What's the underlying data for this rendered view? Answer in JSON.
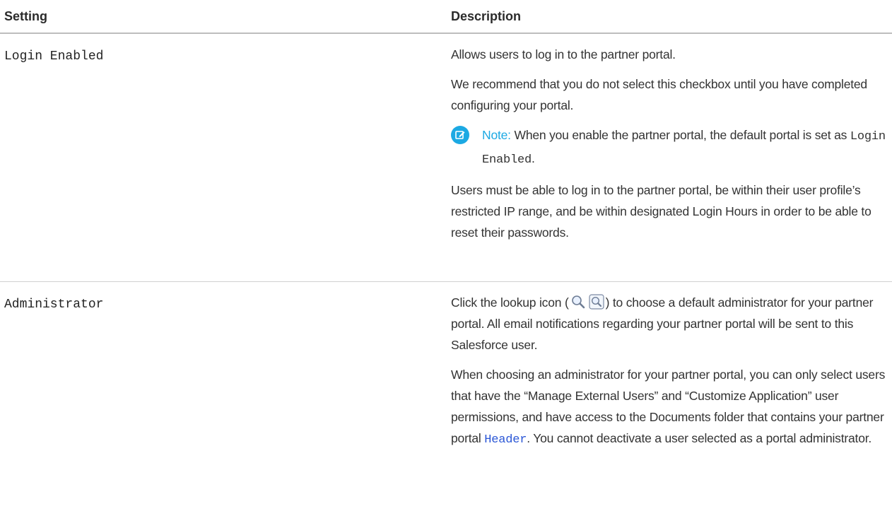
{
  "table": {
    "headers": {
      "setting": "Setting",
      "description": "Description"
    },
    "rows": [
      {
        "setting": "Login Enabled",
        "paragraphs": [
          "Allows users to log in to the partner portal.",
          "We recommend that you do not select this checkbox until you have completed configuring your portal."
        ],
        "note": {
          "label": "Note:",
          "text_before": "When you enable the partner portal, the default portal is set as ",
          "code": "Login Enabled",
          "text_after": "."
        },
        "final_paragraph": "Users must be able to log in to the partner portal, be within their user profile’s restricted IP range, and be within designated Login Hours in order to be able to reset their passwords."
      },
      {
        "setting": "Administrator",
        "p1_before": "Click the lookup icon (",
        "p1_after": ") to choose a default administrator for your partner portal. All email notifications regarding your partner portal will be sent to this Salesforce user.",
        "p2_before": "When choosing an administrator for your partner portal, you can only select users that have the “Manage External Users” and “Customize Application” user permissions, and have access to the Documents folder that contains your partner portal ",
        "p2_link": "Header",
        "p2_after": ". You cannot deactivate a user selected as a portal administrator."
      }
    ]
  },
  "icons": {
    "note": "edit-pencil-icon",
    "lookup": "magnifier-icon"
  },
  "colors": {
    "accent": "#1ca9e3",
    "link": "#2b57d6",
    "rule": "#bdbdbd"
  }
}
